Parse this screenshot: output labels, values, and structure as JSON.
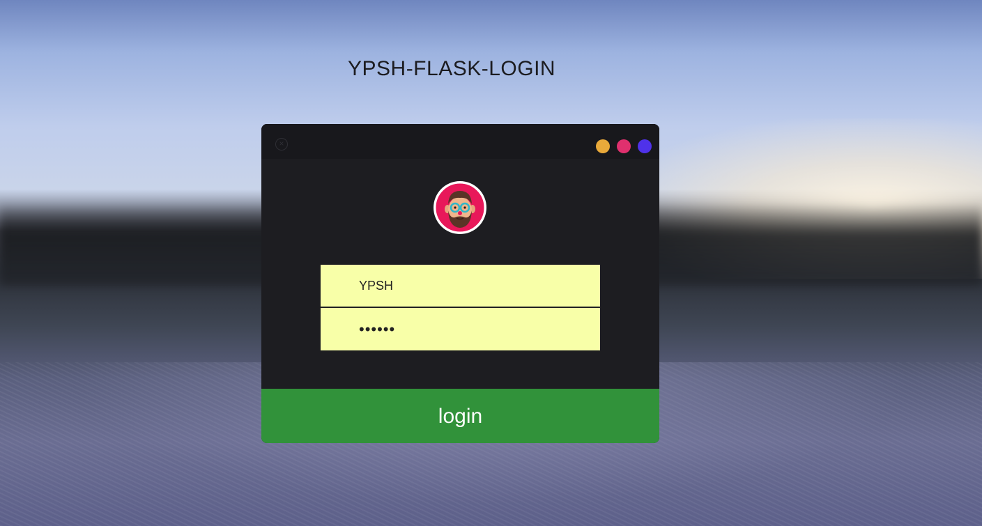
{
  "page": {
    "title": "YPSH-FLASK-LOGIN"
  },
  "dialog": {
    "close_icon": "close-circle-icon",
    "window_dots": [
      {
        "name": "yellow",
        "color": "#e9a93a"
      },
      {
        "name": "pink",
        "color": "#e0306e"
      },
      {
        "name": "purple",
        "color": "#4f32ea"
      }
    ],
    "avatar_icon": "bearded-man-with-glasses-icon",
    "username": {
      "value": "YPSH"
    },
    "password": {
      "value": "••••••"
    },
    "login_label": "login"
  },
  "colors": {
    "dialog_bg": "#1d1d21",
    "input_bg": "#f8ffa8",
    "login_bg": "#31923a",
    "avatar_bg": "#e8185a"
  }
}
